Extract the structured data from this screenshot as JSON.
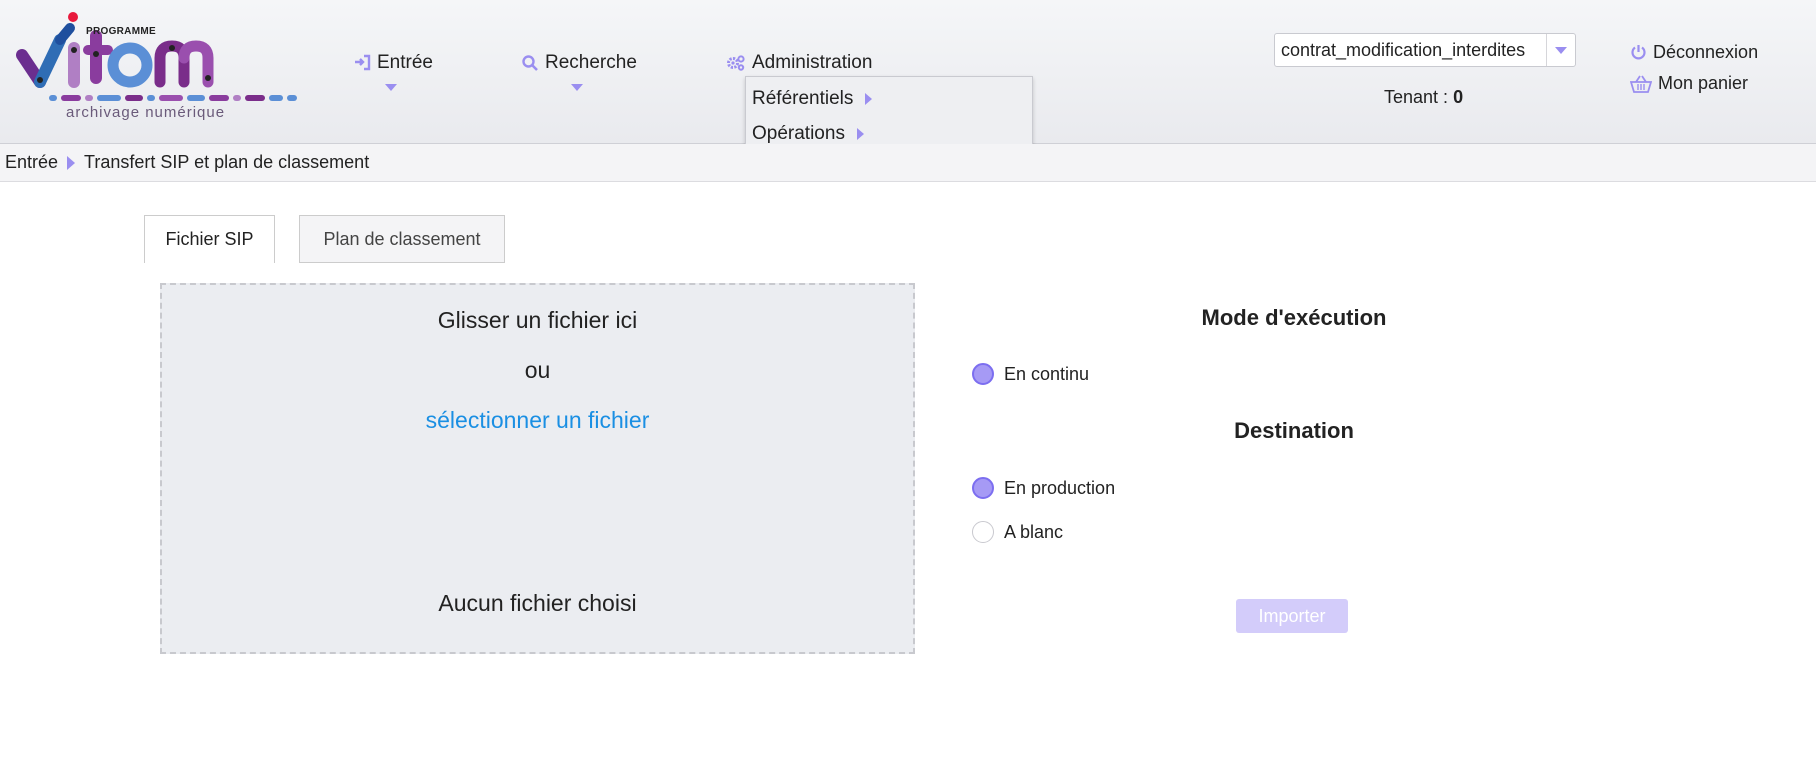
{
  "brand": {
    "programme": "PROGRAMME",
    "tagline": "archivage numérique"
  },
  "nav": {
    "entree": "Entrée",
    "recherche": "Recherche",
    "administration": "Administration"
  },
  "admin_menu": {
    "referentiels": "Référentiels",
    "operations": "Opérations"
  },
  "header": {
    "contract_value": "contrat_modification_interdites",
    "tenant_label": "Tenant :",
    "tenant_value": "0",
    "logout": "Déconnexion",
    "basket": "Mon panier"
  },
  "breadcrumb": {
    "root": "Entrée",
    "current": "Transfert SIP et plan de classement"
  },
  "tabs": [
    {
      "label": "Fichier SIP",
      "active": true
    },
    {
      "label": "Plan de classement",
      "active": false
    }
  ],
  "dropzone": {
    "drag_text": "Glisser un fichier ici",
    "or_text": "ou",
    "select_link": "sélectionner un fichier",
    "status": "Aucun fichier choisi"
  },
  "execution": {
    "title": "Mode d'exécution",
    "options": [
      {
        "label": "En continu",
        "checked": true
      }
    ]
  },
  "destination": {
    "title": "Destination",
    "options": [
      {
        "label": "En production",
        "checked": true
      },
      {
        "label": "A blanc",
        "checked": false
      }
    ]
  },
  "actions": {
    "import": "Importer"
  },
  "colors": {
    "accent": "#9a8ef0",
    "link": "#1a8fe3",
    "button_disabled": "#d3ccfa"
  }
}
